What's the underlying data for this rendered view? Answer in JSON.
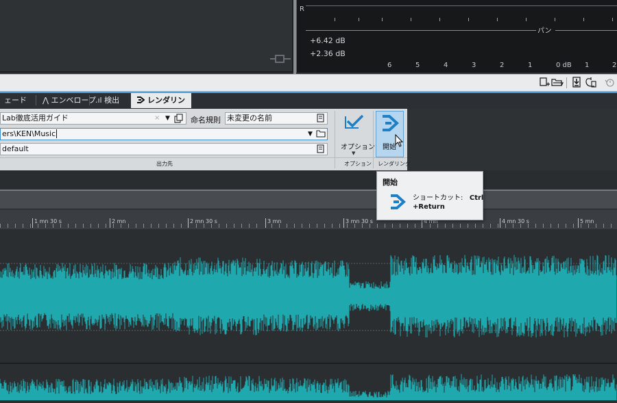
{
  "meter": {
    "channel_label": "R",
    "pan_label": "パン",
    "db_values": [
      "+6.42 dB",
      "+2.36 dB"
    ],
    "scale": [
      "6",
      "5",
      "4",
      "3",
      "2",
      "1",
      "0 dB",
      "1",
      "2"
    ]
  },
  "toolbar": {
    "icons": [
      "new-file-icon",
      "open-folder-icon",
      "save-icon",
      "undo-icon",
      "history-icon"
    ]
  },
  "tabs": [
    {
      "label": "ェード",
      "active": false
    },
    {
      "label": "⋀ エンベロープ",
      "active": false
    },
    {
      "label": ".ıl 検出",
      "active": false
    },
    {
      "label": "レンダリング",
      "active": true
    }
  ],
  "output": {
    "name_value": "Lab徹底活用ガイド",
    "path_value": "ers\\KEN\\Music",
    "format_value": "default",
    "naming_label": "命名規則",
    "naming_value": "未変更の名前",
    "group_label": "出力先"
  },
  "options": {
    "label": "オプション",
    "group_label": "オプション"
  },
  "render": {
    "start_label": "開始",
    "group_label": "レンダリング"
  },
  "tooltip": {
    "title": "開始",
    "shortcut_label": "ショートカット:",
    "shortcut_key_1": "Ctrl",
    "shortcut_key_2": "+Return"
  },
  "ruler": {
    "labels": [
      "1 mn 30 s",
      "2 mn",
      "2 mn 30 s",
      "3 mn",
      "3 mn 30 s",
      "4 mn",
      "4 mn 30 s",
      "5 mn"
    ]
  },
  "colors": {
    "waveform": "#1fa8ad",
    "accent": "#1e7fc4",
    "tab_accent": "#4a9fd4"
  }
}
